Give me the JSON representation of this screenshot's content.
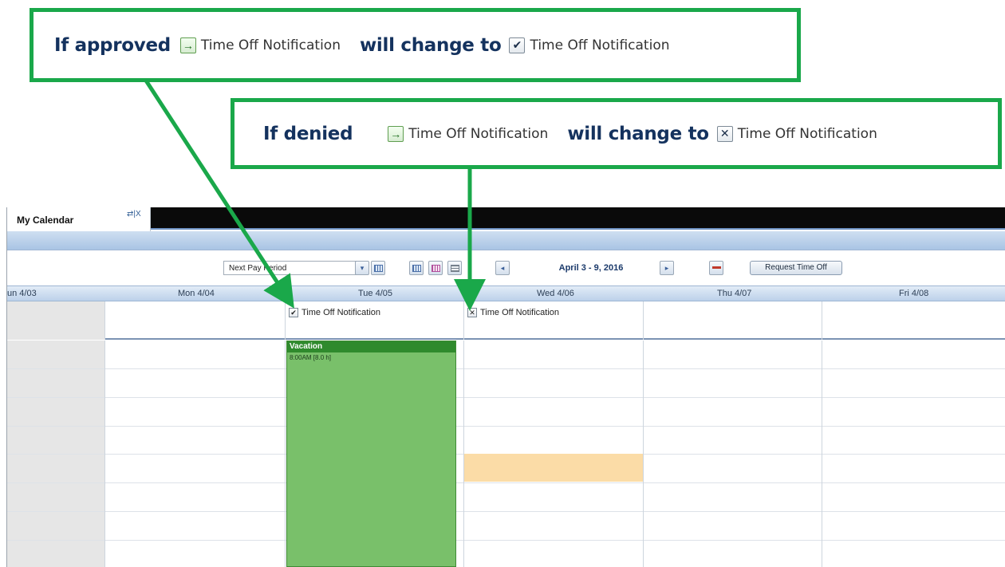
{
  "callouts": {
    "approved": {
      "lead": "If approved",
      "from_label": "Time Off Notification",
      "middle": "will change to",
      "to_label": "Time Off Notification"
    },
    "denied": {
      "lead": "If denied",
      "from_label": "Time Off Notification",
      "middle": "will change to",
      "to_label": "Time Off Notification"
    }
  },
  "colors": {
    "callout_border": "#1aa84a",
    "callout_text": "#14325e",
    "vacation_block": "#79c06a",
    "pending_slot": "#fbdca7"
  },
  "tab": {
    "title": "My Calendar",
    "icons": [
      "swap-icon",
      "close-icon"
    ],
    "separator": "|",
    "close_glyph": "X"
  },
  "toolbar": {
    "period_value": "Next Pay Period",
    "date_range": "April 3 - 9, 2016",
    "request_button": "Request Time Off"
  },
  "days": [
    "un 4/03",
    "Mon 4/04",
    "Tue 4/05",
    "Wed 4/06",
    "Thu 4/07",
    "Fri 4/08"
  ],
  "all_day": {
    "tue": "Time Off Notification",
    "wed": "Time Off Notification"
  },
  "event": {
    "title": "Vacation",
    "time": "8:00AM [8.0 h]"
  }
}
